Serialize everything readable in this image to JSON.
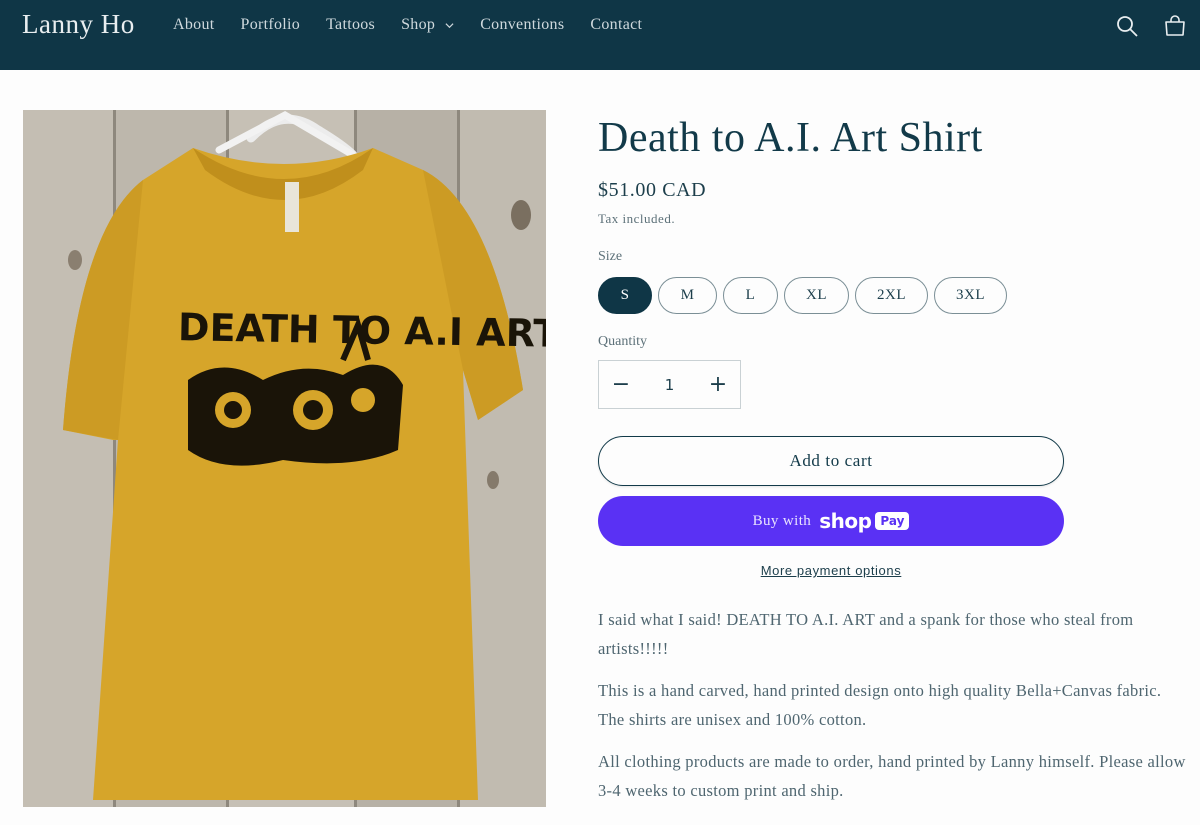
{
  "header": {
    "brand": "Lanny Ho",
    "nav": [
      "About",
      "Portfolio",
      "Tattoos",
      "Shop",
      "Conventions",
      "Contact"
    ],
    "icons": [
      "search-icon",
      "cart-icon"
    ]
  },
  "product": {
    "title": "Death to A.I. Art Shirt",
    "price": "$51.00 CAD",
    "tax_note": "Tax included.",
    "size_label": "Size",
    "sizes": [
      "S",
      "M",
      "L",
      "XL",
      "2XL",
      "3XL"
    ],
    "selected_size": "S",
    "quantity_label": "Quantity",
    "quantity": "1",
    "qty_minus": "−",
    "qty_plus": "+",
    "add_to_cart": "Add to cart",
    "shop_pay": {
      "buy_with": "Buy with",
      "shop": "shop",
      "pay": "Pay"
    },
    "more_payment": "More payment options",
    "description": [
      "I said what I said! DEATH TO A.I. ART and a spank for those who steal from artists!!!!!",
      "This is a hand carved, hand printed design onto high quality Bella+Canvas fabric. The shirts are unisex and 100% cotton.",
      "All clothing products are made to order, hand printed by Lanny himself. Please allow 3-4 weeks to custom print and ship."
    ],
    "shirt_print_text": "DEATH TO A.I ART"
  },
  "colors": {
    "header_bg": "#0f3646",
    "accent": "#123a49",
    "shop_pay": "#5a31f4",
    "shirt": "#d9a82c"
  }
}
